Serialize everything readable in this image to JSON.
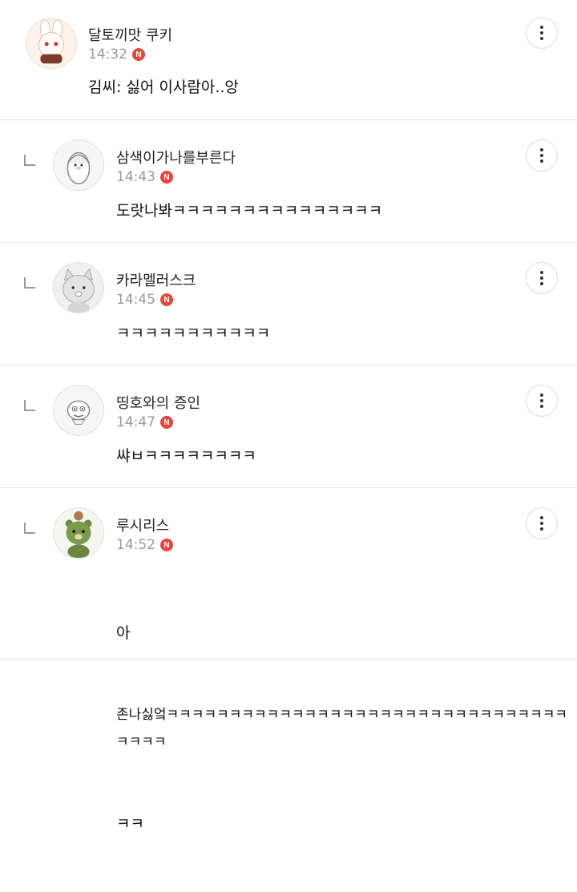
{
  "comments": [
    {
      "nickname": "달토끼맛 쿠키",
      "time": "14:32",
      "badge": "N",
      "lines": [
        "김씨: 싫어 이사람아..앙"
      ],
      "avatar": "rabbit-cookie-avatar",
      "is_reply": false
    },
    {
      "nickname": "삼색이가나를부른다",
      "time": "14:43",
      "badge": "N",
      "lines": [
        "도랏나봐ㅋㅋㅋㅋㅋㅋㅋㅋㅋㅋㅋㅋㅋㅋㅋ"
      ],
      "avatar": "penguin-avatar",
      "is_reply": true
    },
    {
      "nickname": "카라멜러스크",
      "time": "14:45",
      "badge": "N",
      "lines": [
        "ㅋㅋㅋㅋㅋㅋㅋㅋㅋㅋㅋ"
      ],
      "avatar": "cat-avatar",
      "is_reply": true
    },
    {
      "nickname": "띵호와의 증인",
      "time": "14:47",
      "badge": "N",
      "lines": [
        "쌰ㅂㅋㅋㅋㅋㅋㅋㅋㅋ"
      ],
      "avatar": "character-avatar",
      "is_reply": true
    },
    {
      "nickname": "루시리스",
      "time": "14:52",
      "badge": "N",
      "lines": [
        "아",
        "존나싫엌ㅋㅋㅋㅋㅋㅋㅋㅋㅋㅋㅋㅋㅋㅋㅋㅋㅋㅋㅋㅋㅋㅋㅋㅋㅋㅋㅋㅋㅋㅋㅋㅋㅋㅋㅋㅋ",
        "ㅋㅋ"
      ],
      "avatar": "bear-avatar",
      "is_reply": true
    }
  ],
  "colors": {
    "badge": "#e5473e",
    "time": "#9a9a9a",
    "divider": "#e6e6e6"
  }
}
